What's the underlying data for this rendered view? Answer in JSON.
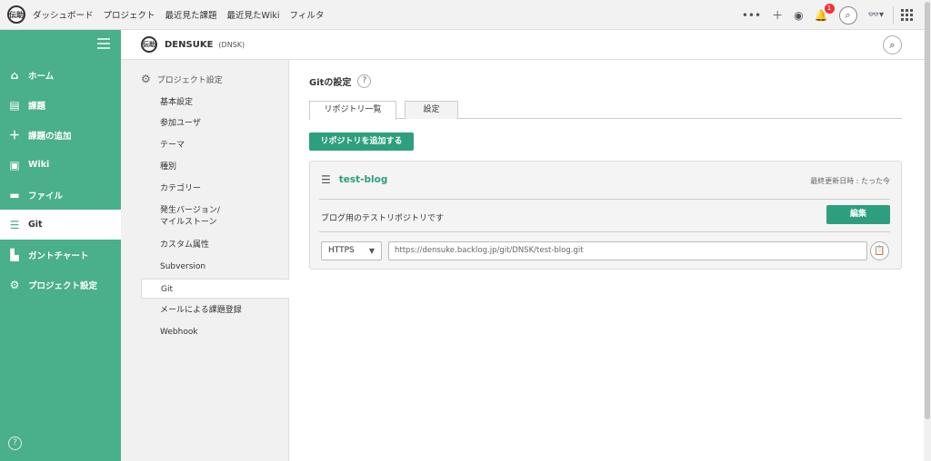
{
  "topnav": {
    "logo_text": "伝助",
    "items": [
      "ダッシュボード",
      "プロジェクト",
      "最近見た課題",
      "最近見たWiki",
      "フィルタ"
    ],
    "notification_count": "1"
  },
  "leftnav": {
    "items": [
      {
        "label": "ホーム",
        "icon": "home-icon"
      },
      {
        "label": "課題",
        "icon": "list-icon"
      },
      {
        "label": "課題の追加",
        "icon": "plus-icon"
      },
      {
        "label": "Wiki",
        "icon": "wiki-icon"
      },
      {
        "label": "ファイル",
        "icon": "folder-icon"
      },
      {
        "label": "Git",
        "icon": "git-icon"
      },
      {
        "label": "ガントチャート",
        "icon": "gantt-icon"
      },
      {
        "label": "プロジェクト設定",
        "icon": "gear-icon"
      }
    ],
    "active": "Git",
    "help": "?"
  },
  "project": {
    "logo_text": "伝助",
    "name": "DENSUKE",
    "key": "(DNSK)"
  },
  "settings_nav": {
    "heading": "プロジェクト設定",
    "items": [
      "基本設定",
      "参加ユーザ",
      "テーマ",
      "種別",
      "カテゴリー",
      "発生バージョン/",
      "マイルストーン",
      "カスタム属性",
      "Subversion",
      "Git",
      "メールによる課題登録",
      "Webhook"
    ],
    "active": "Git"
  },
  "main": {
    "title": "Gitの設定",
    "help": "?",
    "tabs": [
      "リポジトリ一覧",
      "設定"
    ],
    "add_repo_label": "リポジトリを追加する",
    "repo": {
      "name": "test-blog",
      "last_updated": "最終更新日時 : たった今",
      "description": "ブログ用のテストリポジトリです",
      "edit_label": "編集",
      "protocol": "HTTPS",
      "url": "https://densuke.backlog.jp/git/DNSK/test-blog.git"
    }
  }
}
